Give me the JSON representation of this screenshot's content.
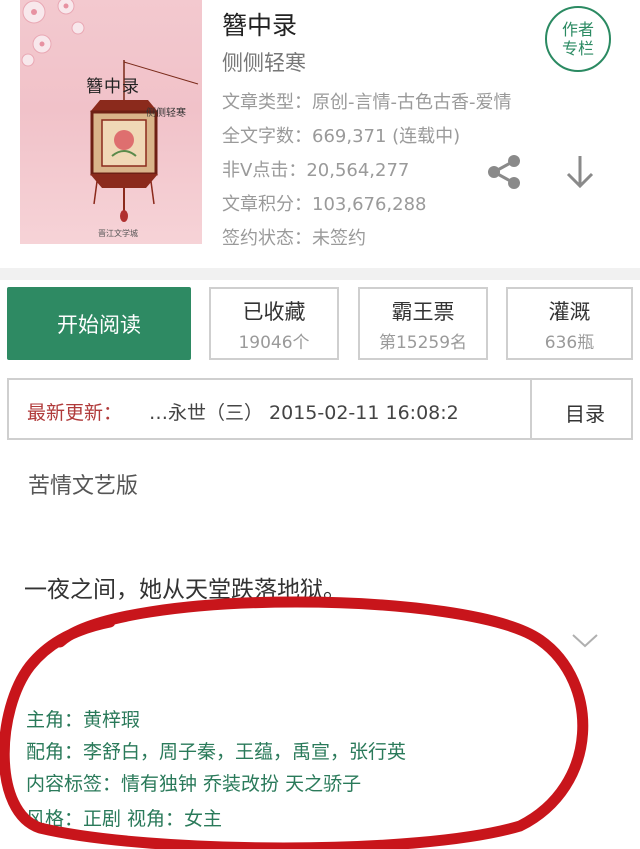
{
  "book": {
    "title": "簪中录",
    "author": "侧侧轻寒",
    "cover": {
      "title": "簪中录",
      "author": "侧侧轻寒",
      "publisher": "晋江文学城"
    },
    "meta": {
      "type": "文章类型：原创-言情-古色古香-爱情",
      "word_count": "全文字数：669,371 (连载中)",
      "clicks": "非V点击：20,564,277",
      "score": "文章积分：103,676,288",
      "contract": "签约状态：未签约"
    },
    "author_badge": [
      "作者",
      "专栏"
    ]
  },
  "actions": {
    "read_label": "开始阅读",
    "favorites": {
      "label": "已收藏",
      "value": "19046个"
    },
    "tickets": {
      "label": "霸王票",
      "value": "第15259名"
    },
    "nutrient": {
      "label": "灌溉",
      "value": "636瓶"
    }
  },
  "update": {
    "label": "最新更新：",
    "text": "…永世（三）   2015-02-11 16:08:2",
    "catalog": "目录"
  },
  "content": {
    "intro_title": "苦情文艺版",
    "intro_line": "一夜之间，她从天堂跌落地狱。",
    "protagonist": "主角：黄梓瑕",
    "supporting": "配角：李舒白，周子秦，王蕴，禹宣，张行英",
    "tags": "内容标签：情有独钟 乔装改扮 天之骄子",
    "style": "风格：正剧      视角：女主"
  },
  "colors": {
    "accent_green": "#2e8a63",
    "annotation_red": "#c8151b",
    "update_label": "#b03a3a"
  },
  "icons": [
    "share-icon",
    "download-icon",
    "chevron-down-icon"
  ]
}
